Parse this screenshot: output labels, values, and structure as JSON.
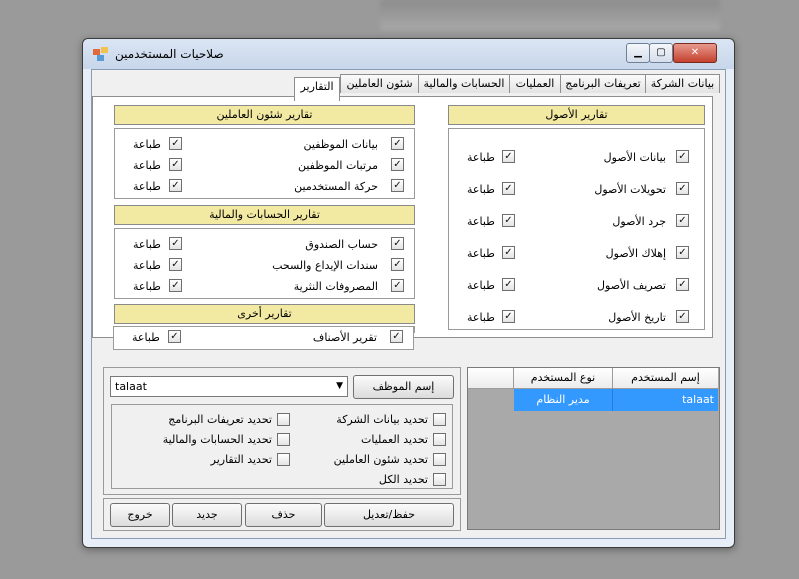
{
  "window": {
    "title": "صلاحيات المستخدمين"
  },
  "tabs": [
    {
      "label": "بيانات الشركة"
    },
    {
      "label": "تعريفات البرنامج"
    },
    {
      "label": "العمليات"
    },
    {
      "label": "الحسابات والمالية"
    },
    {
      "label": "شئون العاملين"
    },
    {
      "label": "التقارير"
    }
  ],
  "assets_reports": {
    "header": "تقارير الأصول",
    "items": [
      {
        "label": "بيانات الأصول",
        "print": "طباعة"
      },
      {
        "label": "تحويلات الأصول",
        "print": "طباعة"
      },
      {
        "label": "جرد الأصول",
        "print": "طباعة"
      },
      {
        "label": "إهلاك الأصول",
        "print": "طباعة"
      },
      {
        "label": "تصريف الأصول",
        "print": "طباعة"
      },
      {
        "label": "تاريخ الأصول",
        "print": "طباعة"
      }
    ]
  },
  "hr_reports": {
    "header": "تقارير شئون العاملين",
    "items": [
      {
        "label": "بيانات الموظفين",
        "print": "طباعة"
      },
      {
        "label": "مرتبات الموظفين",
        "print": "طباعة"
      },
      {
        "label": "حركة المستخدمين",
        "print": "طباعة"
      }
    ]
  },
  "finance_reports": {
    "header": "تقارير الحسابات والمالية",
    "items": [
      {
        "label": "حساب الصندوق",
        "print": "طباعة"
      },
      {
        "label": "سندات الإيداع والسحب",
        "print": "طباعة"
      },
      {
        "label": "المصروفات النثرية",
        "print": "طباعة"
      }
    ]
  },
  "other_reports": {
    "header": "تقارير أخرى",
    "items": [
      {
        "label": "تقرير الأصناف",
        "print": "طباعة"
      }
    ]
  },
  "employee": {
    "button_label": "إسم الموظف",
    "selected": "talaat"
  },
  "select_options": {
    "company": "تحديد بيانات الشركة",
    "definitions": "تحديد تعريفات البرنامج",
    "operations": "تحديد العمليات",
    "finance": "تحديد الحسابات والمالية",
    "hr": "تحديد شئون العاملين",
    "reports": "تحديد التقارير",
    "all": "تحديد الكل"
  },
  "users_grid": {
    "columns": [
      "إسم المستخدم",
      "نوع المستخدم"
    ],
    "rows": [
      {
        "username": "talaat",
        "type": "مدير النظام"
      }
    ]
  },
  "actions": {
    "save": "حفظ/تعديل",
    "delete": "حذف",
    "new": "جديد",
    "exit": "خروج"
  },
  "colors": {
    "section_header": "#f2e9a3",
    "selection": "#3399ff"
  }
}
